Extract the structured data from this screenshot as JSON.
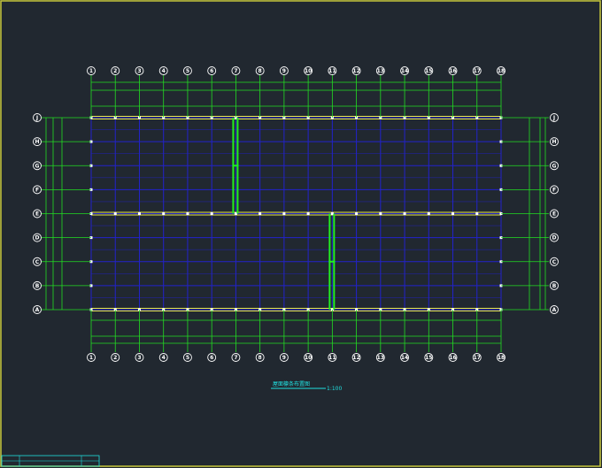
{
  "drawing": {
    "background": "#212830",
    "frame_color": "#c8c83c",
    "grid_color": "#2222cc",
    "dim_color": "#22dd22",
    "beam_color": "#e8e84a",
    "brace_color": "#22ee22",
    "caption_color": "#20e0e0",
    "column_axes": [
      "1",
      "2",
      "3",
      "4",
      "5",
      "6",
      "7",
      "8",
      "9",
      "10",
      "11",
      "12",
      "13",
      "14",
      "15",
      "16",
      "17",
      "18"
    ],
    "row_axes": [
      "J",
      "H",
      "G",
      "F",
      "E",
      "D",
      "C",
      "B",
      "A"
    ],
    "bracing_bays": [
      {
        "column_axis": "7",
        "from_row": "J",
        "to_row": "E"
      },
      {
        "column_axis": "11",
        "from_row": "E",
        "to_row": "A"
      }
    ],
    "caption": {
      "title": "屋面檩条布置图",
      "scale": "1:100"
    },
    "title_block": {
      "visible": true
    }
  }
}
